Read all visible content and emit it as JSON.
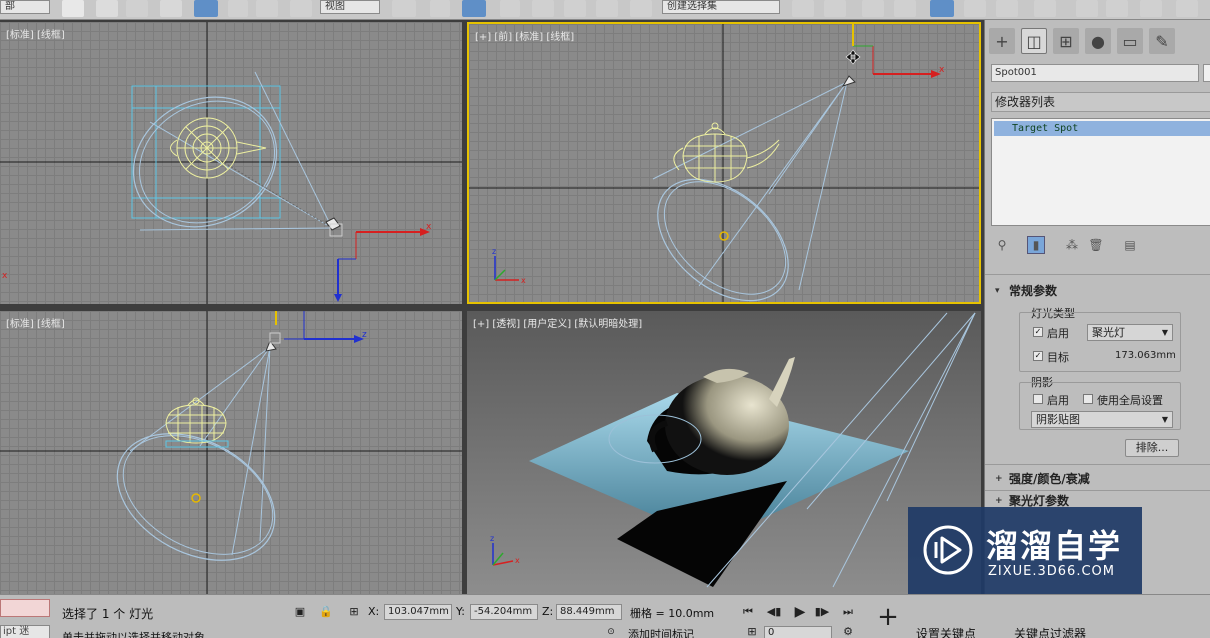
{
  "toolbar": {
    "selection_set_left": "部",
    "ref_coord": "视图",
    "named_selection": "创建选择集"
  },
  "viewports": {
    "top": {
      "label": "[标准] [线框]"
    },
    "front": {
      "label": "[+] [前] [标准] [线框]"
    },
    "left": {
      "label": "[标准] [线框]"
    },
    "perspective": {
      "label": "[+] [透视] [用户定义] [默认明暗处理]"
    }
  },
  "axes": {
    "x": "x",
    "y": "y",
    "z": "z"
  },
  "panel": {
    "object_name": "Spot001",
    "modifier_list": "修改器列表",
    "stack_item": "Target Spot",
    "general": {
      "title": "常规参数",
      "light_type_label": "灯光类型",
      "enable_label": "启用",
      "enable_checked": "✓",
      "light_type": "聚光灯",
      "target_label": "目标",
      "target_checked": "✓",
      "target_distance": "173.063mm",
      "shadow_label": "阴影",
      "shadow_enable_label": "启用",
      "global_label": "使用全局设置",
      "shadow_type": "阴影贴图",
      "exclude_button": "排除..."
    },
    "intensity_rollout": "强度/颜色/衰减",
    "spot_rollout": "聚光灯参数"
  },
  "status": {
    "maxscript_label": "ipt 迷",
    "selection_text": "选择了 1 个 灯光",
    "prompt_text": "单击并拖动以选择并移动对象",
    "x_label": "X:",
    "x_value": "103.047mm",
    "y_label": "Y:",
    "y_value": "-54.204mm",
    "z_label": "Z:",
    "z_value": "88.449mm",
    "grid_text": "栅格 = 10.0mm",
    "add_time_tag": "添加时间标记",
    "frame_value": "0",
    "set_key": "设置关键点",
    "key_filters": "关键点过滤器"
  },
  "watermark": {
    "title": "溜溜自学",
    "url": "ZIXUE.3D66.COM"
  },
  "colors": {
    "grid": "#8a8a8a",
    "active_border": "#e6c200",
    "teapot_wire": "#eef0a0",
    "light_cone": "#a9c6de",
    "stack_highlight": "#8fb2de",
    "watermark_bg": "#1e3a66"
  }
}
